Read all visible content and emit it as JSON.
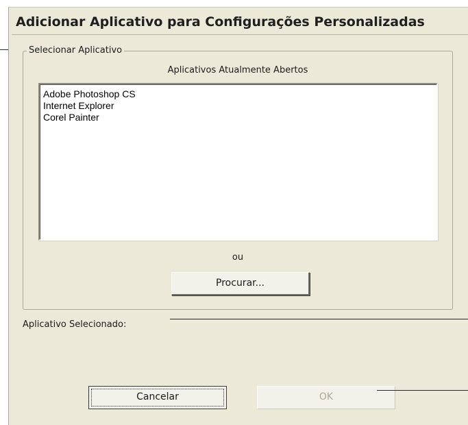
{
  "dialog": {
    "title": "Adicionar Aplicativo para Configurações Personalizadas",
    "group": {
      "legend": "Selecionar Aplicativo",
      "list_caption": "Aplicativos Atualmente Abertos",
      "open_apps": [
        "Adobe Photoshop CS",
        "Internet Explorer",
        "Corel Painter"
      ],
      "or_text": "ou",
      "browse_label": "Procurar..."
    },
    "selected_label": "Aplicativo Selecionado:",
    "selected_value": "",
    "buttons": {
      "cancel_label": "Cancelar",
      "ok_label": "OK",
      "ok_enabled": false
    }
  },
  "colors": {
    "dialog_bg": "#ece9d8",
    "disabled_text": "#aca899"
  }
}
